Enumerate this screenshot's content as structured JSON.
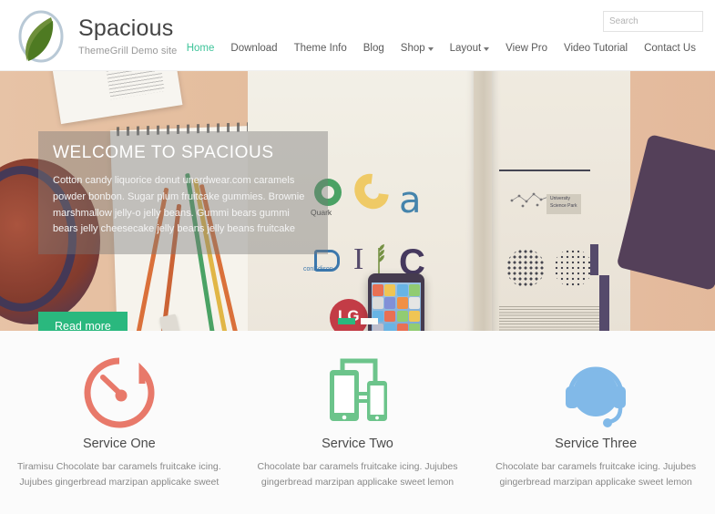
{
  "header": {
    "site_title": "Spacious",
    "site_description": "ThemeGrill Demo site",
    "logo_icon": "leaf-logo-icon",
    "search": {
      "placeholder": "Search",
      "value": "",
      "button_icon": "search-icon",
      "button_color": "#27b67e"
    },
    "nav": [
      {
        "label": "Home",
        "active": true,
        "dropdown": false
      },
      {
        "label": "Download",
        "active": false,
        "dropdown": false
      },
      {
        "label": "Theme Info",
        "active": false,
        "dropdown": false
      },
      {
        "label": "Blog",
        "active": false,
        "dropdown": false
      },
      {
        "label": "Shop",
        "active": false,
        "dropdown": true
      },
      {
        "label": "Layout",
        "active": false,
        "dropdown": true
      },
      {
        "label": "View Pro",
        "active": false,
        "dropdown": false
      },
      {
        "label": "Video Tutorial",
        "active": false,
        "dropdown": false
      },
      {
        "label": "Contact Us",
        "active": false,
        "dropdown": false
      }
    ]
  },
  "hero": {
    "title": "WELCOME TO SPACIOUS",
    "text": "Cotton candy liquorice donut unerdwear.com caramels powder bonbon. Sugar plum fruitcake gummies. Brownie marshmallow jelly-o jelly beans. Gummi bears gummi bears jelly cheesecake jelly beans jelly beans fruitcake",
    "button_label": "Read more",
    "button_color": "#2ab87e",
    "slides_total": 2,
    "slide_active": 1,
    "image_description": "Desk flatlay with open magazine showing brand logos, smartphone, notepad and coloured pencils",
    "magazine_logos": [
      "Quark",
      "conEdison",
      "LG"
    ],
    "magazine_right_page_label": "University Science Park"
  },
  "services": [
    {
      "icon": "speedometer-icon",
      "icon_color": "#e8796a",
      "title": "Service One",
      "description": "Tiramisu Chocolate bar caramels fruitcake icing. Jujubes gingerbread marzipan applicake sweet"
    },
    {
      "icon": "responsive-devices-icon",
      "icon_color": "#6cc48b",
      "title": "Service Two",
      "description": "Chocolate bar caramels fruitcake icing. Jujubes gingerbread marzipan applicake sweet lemon"
    },
    {
      "icon": "headset-support-icon",
      "icon_color": "#81b9e8",
      "title": "Service Three",
      "description": "Chocolate bar caramels fruitcake icing. Jujubes gingerbread marzipan applicake sweet lemon"
    }
  ]
}
